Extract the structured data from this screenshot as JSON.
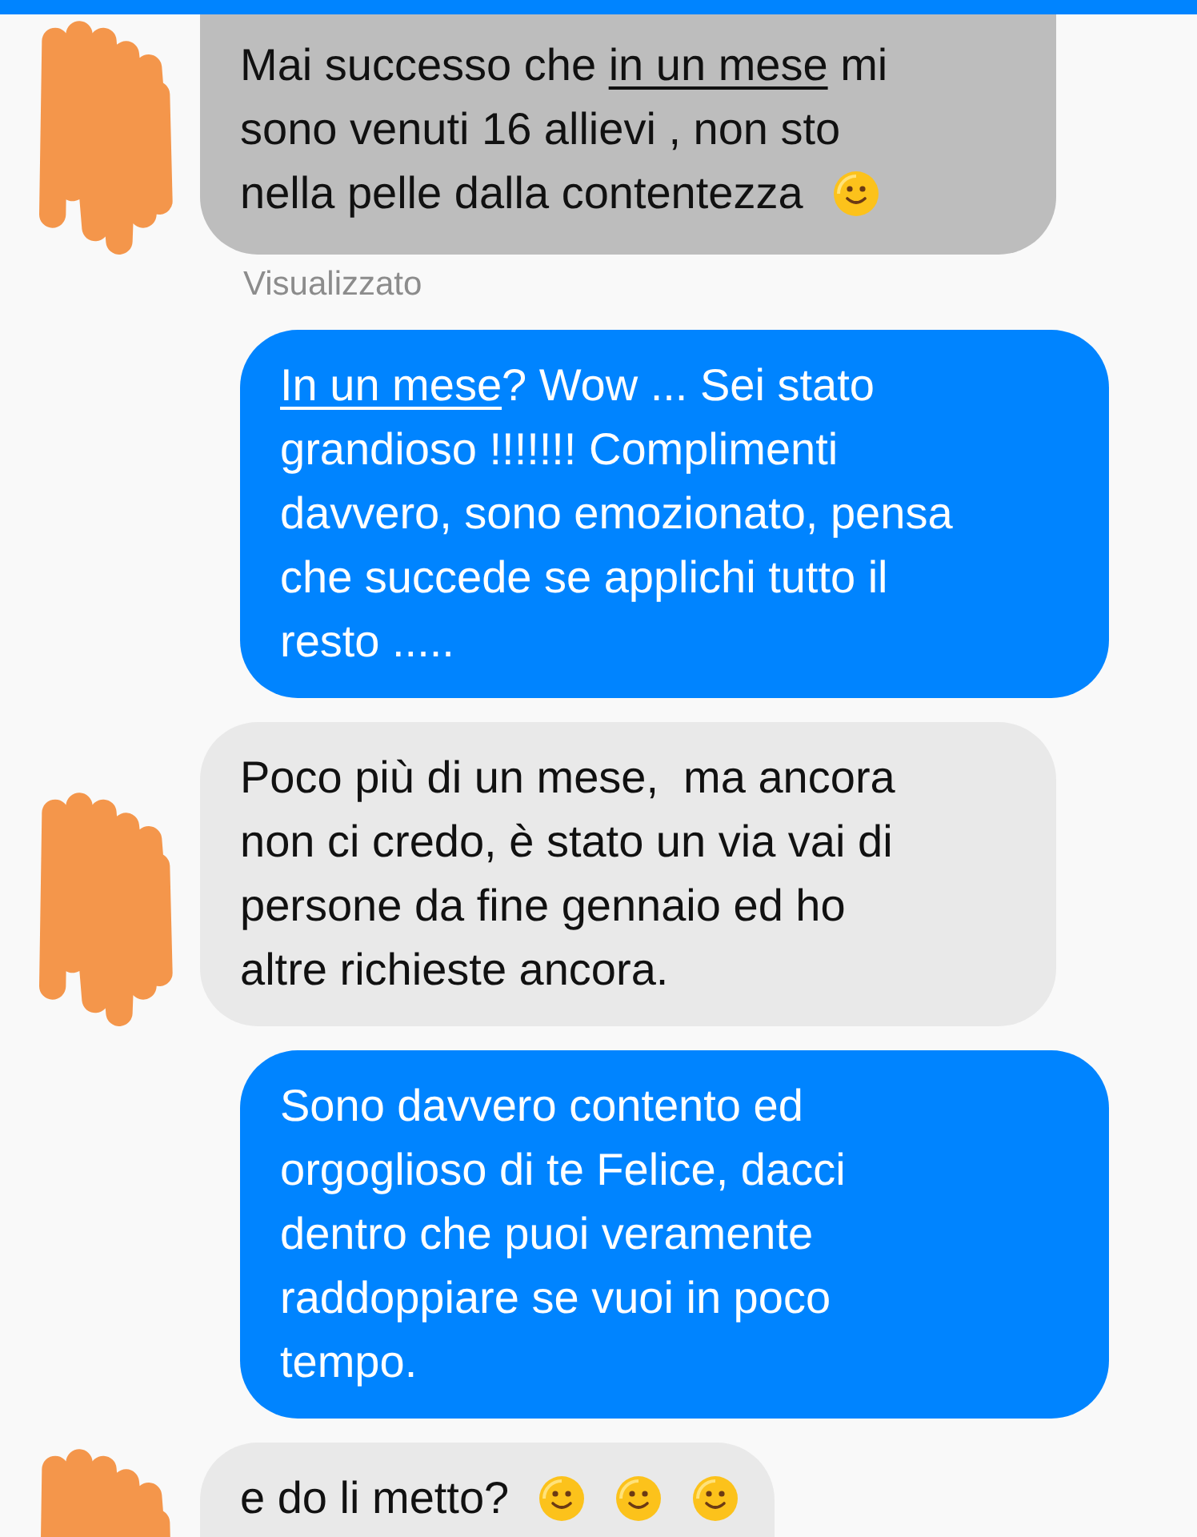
{
  "messages": [
    {
      "kind": "incoming",
      "selected": true,
      "lines": [
        [
          {
            "kind": "text",
            "text": "Mai successo che "
          },
          {
            "kind": "underline",
            "text": "in un mese"
          },
          {
            "kind": "text",
            "text": " mi"
          }
        ],
        [
          {
            "kind": "text",
            "text": "sono venuti 16 allievi , non sto"
          }
        ],
        [
          {
            "kind": "text",
            "text": "nella pelle dalla contentezza"
          },
          {
            "kind": "emoji"
          }
        ]
      ],
      "status": "Visualizzato"
    },
    {
      "kind": "outgoing",
      "selected": false,
      "lines": [
        [
          {
            "kind": "underline",
            "text": "In un mese"
          },
          {
            "kind": "text",
            "text": "? Wow ... Sei stato"
          }
        ],
        [
          {
            "kind": "text",
            "text": "grandioso !!!!!!! Complimenti"
          }
        ],
        [
          {
            "kind": "text",
            "text": "davvero, sono emozionato, pensa"
          }
        ],
        [
          {
            "kind": "text",
            "text": "che succede se applichi tutto il"
          }
        ],
        [
          {
            "kind": "text",
            "text": "resto ....."
          }
        ]
      ]
    },
    {
      "kind": "incoming",
      "selected": false,
      "lines": [
        [
          {
            "kind": "text",
            "text": "Poco più di un mese,  ma ancora"
          }
        ],
        [
          {
            "kind": "text",
            "text": "non ci credo, è stato un via vai di"
          }
        ],
        [
          {
            "kind": "text",
            "text": "persone da fine gennaio ed ho"
          }
        ],
        [
          {
            "kind": "text",
            "text": "altre richieste ancora."
          }
        ]
      ]
    },
    {
      "kind": "outgoing",
      "selected": false,
      "lines": [
        [
          {
            "kind": "text",
            "text": "Sono davvero contento ed"
          }
        ],
        [
          {
            "kind": "text",
            "text": "orgoglioso di te Felice, dacci"
          }
        ],
        [
          {
            "kind": "text",
            "text": "dentro che puoi veramente"
          }
        ],
        [
          {
            "kind": "text",
            "text": "raddoppiare se vuoi in poco"
          }
        ],
        [
          {
            "kind": "text",
            "text": "tempo."
          }
        ]
      ]
    },
    {
      "kind": "incoming",
      "selected": false,
      "lines": [
        [
          {
            "kind": "text",
            "text": "e do li metto?"
          },
          {
            "kind": "emoji"
          },
          {
            "kind": "emoji"
          },
          {
            "kind": "emoji"
          }
        ]
      ]
    }
  ]
}
